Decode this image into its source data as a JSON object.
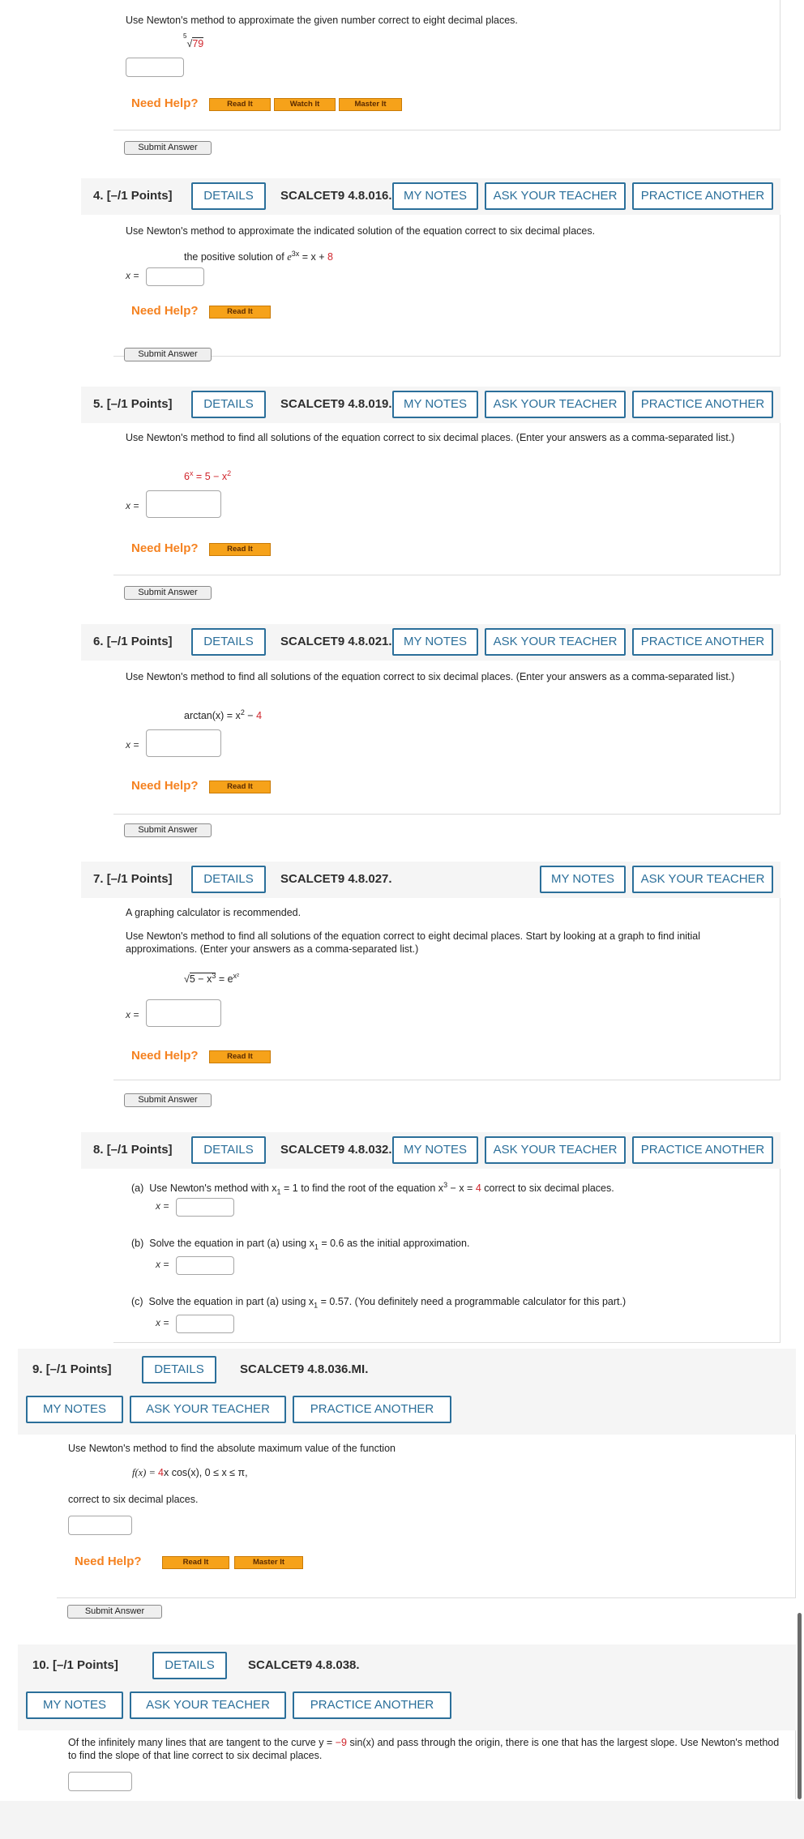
{
  "colors": {
    "link_blue": "#2b6f9a",
    "help_orange": "#f58220",
    "accent_red": "#d0252c",
    "btn_orange": "#f6a21a"
  },
  "buttons": {
    "details": "DETAILS",
    "my_notes": "MY NOTES",
    "ask_teacher": "ASK YOUR TEACHER",
    "practice": "PRACTICE ANOTHER",
    "read_it": "Read It",
    "watch_it": "Watch It",
    "master_it": "Master It",
    "submit": "Submit Answer",
    "need_help": "Need Help?"
  },
  "x_label": "x =",
  "q3": {
    "instruction": "Use Newton's method to approximate the given number correct to eight decimal places.",
    "root_index": "5",
    "radicand": "79"
  },
  "q4": {
    "number": "4.",
    "points": "[–/1 Points]",
    "code": "SCALCET9 4.8.016.",
    "instruction": "Use Newton's method to approximate the indicated solution of the equation correct to six decimal places.",
    "eq_prefix": "the positive solution of",
    "eq_base": "e",
    "eq_exp": "3x",
    "eq_mid": " = x + ",
    "eq_const": "8"
  },
  "q5": {
    "number": "5.",
    "points": "[–/1 Points]",
    "code": "SCALCET9 4.8.019.",
    "instruction": "Use Newton's method to find all solutions of the equation correct to six decimal places. (Enter your answers as a comma-separated list.)",
    "eq_left": "6",
    "eq_left_exp": "x",
    "eq_right": " = 5 − x",
    "eq_right_exp": "2"
  },
  "q6": {
    "number": "6.",
    "points": "[–/1 Points]",
    "code": "SCALCET9 4.8.021.",
    "instruction": "Use Newton's method to find all solutions of the equation correct to six decimal places. (Enter your answers as a comma-separated list.)",
    "eq_left": "arctan(x) = x",
    "eq_exp": "2",
    "eq_mid": " − ",
    "eq_const": "4"
  },
  "q7": {
    "number": "7.",
    "points": "[–/1 Points]",
    "code": "SCALCET9 4.8.027.",
    "note": "A graphing calculator is recommended.",
    "instruction": "Use Newton's method to find all solutions of the equation correct to eight decimal places. Start by looking at a graph to find initial approximations. (Enter your answers as a comma-separated list.)",
    "rad_a": "5 − x",
    "rad_exp": "3",
    "eq_right": " = e",
    "eq_right_exp": "x²"
  },
  "q8": {
    "number": "8.",
    "points": "[–/1 Points]",
    "code": "SCALCET9 4.8.032.",
    "a_label": "(a)",
    "a_text1": "Use Newton's method with x",
    "a_sub": "1",
    "a_text2": " = 1 to find the root of the equation x",
    "a_exp": "3",
    "a_text3": " − x = ",
    "a_const": "4",
    "a_text4": " correct to six decimal places.",
    "b_label": "(b)",
    "b_text1": "Solve the equation in part (a) using x",
    "b_sub": "1",
    "b_text2": " = 0.6 as the initial approximation.",
    "c_label": "(c)",
    "c_text1": "Solve the equation in part (a) using x",
    "c_sub": "1",
    "c_text2": " = 0.57. (You definitely need a programmable calculator for this part.)"
  },
  "q9": {
    "number": "9.",
    "points": "[–/1 Points]",
    "code": "SCALCET9 4.8.036.MI.",
    "instruction": "Use Newton's method to find the absolute maximum value of the function",
    "f_left": "f(x) = ",
    "f_coef": "4",
    "f_rest": "x cos(x),    0 ≤ x ≤ π,",
    "outro": "correct to six decimal places."
  },
  "q10": {
    "number": "10.",
    "points": "[–/1 Points]",
    "code": "SCALCET9 4.8.038.",
    "text1": "Of the infinitely many lines that are tangent to the curve y = ",
    "coef": "−9",
    "text2": " sin(x) and pass through the origin, there is one that has the largest slope. Use Newton's method to find the slope of that line correct to six decimal places."
  }
}
